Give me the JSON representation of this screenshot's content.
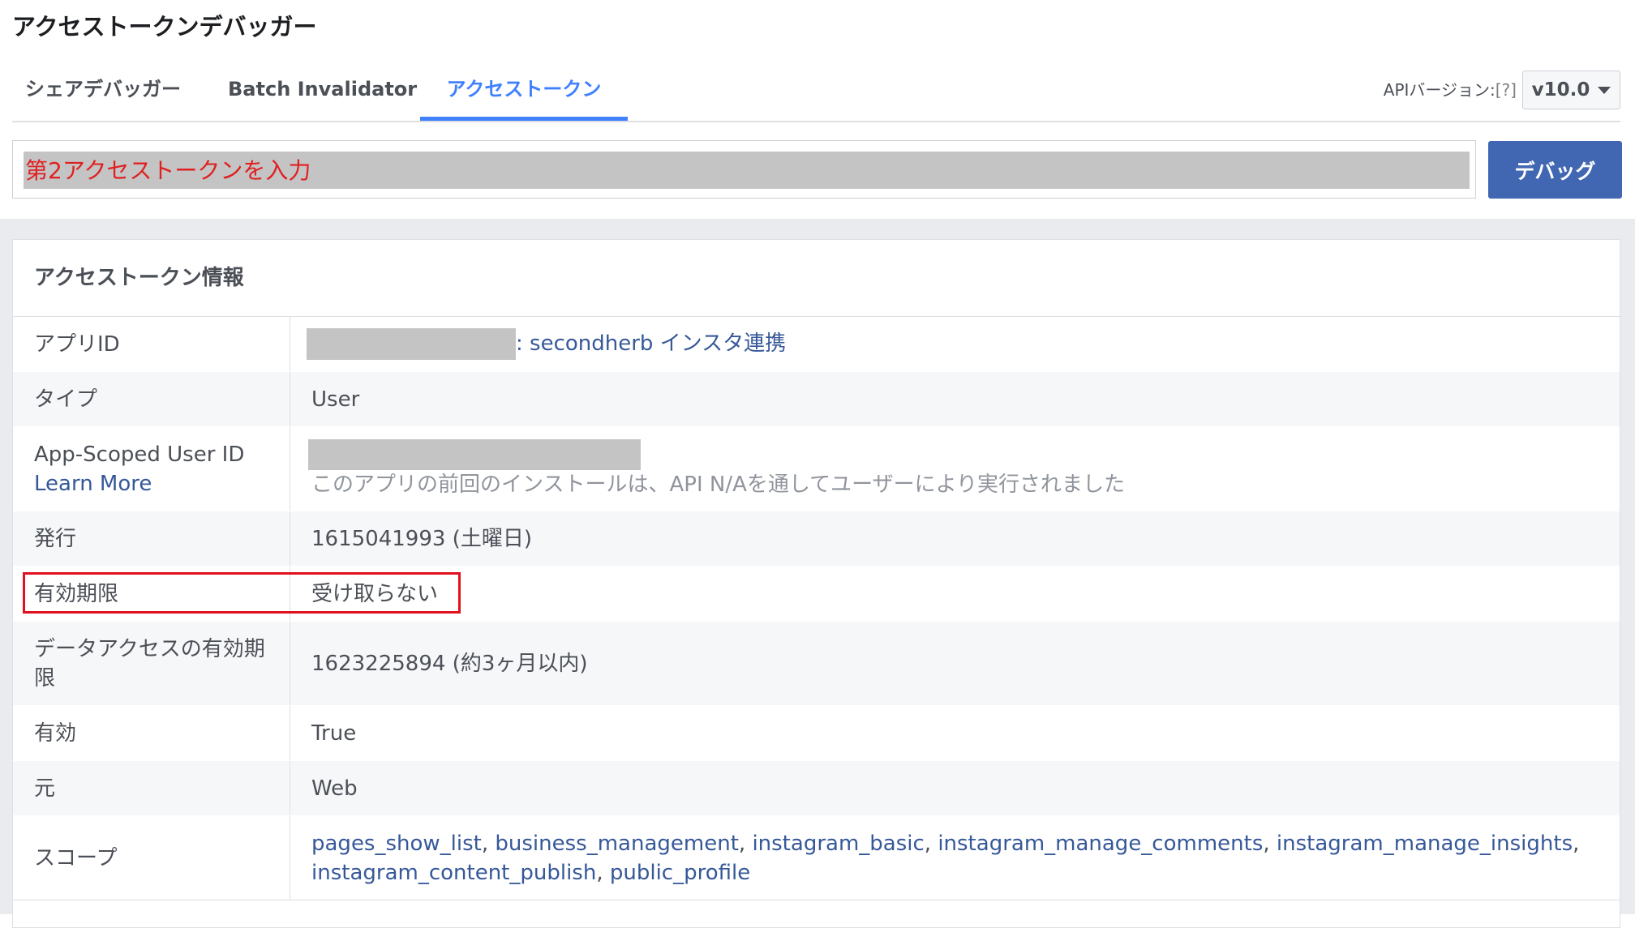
{
  "page_title": "アクセストークンデバッガー",
  "tabs": [
    {
      "label": "シェアデバッガー",
      "active": false
    },
    {
      "label": "Batch Invalidator",
      "active": false
    },
    {
      "label": "アクセストークン",
      "active": true
    }
  ],
  "api_version": {
    "label": "APIバージョン:",
    "help": "[?]",
    "selected": "v10.0"
  },
  "token_input": {
    "placeholder": "第2アクセストークンを入力"
  },
  "debug_button": "デバッグ",
  "panel": {
    "title": "アクセストークン情報",
    "rows": {
      "app_id": {
        "label": "アプリID",
        "value": ": secondherb インスタ連携"
      },
      "type": {
        "label": "タイプ",
        "value": "User"
      },
      "app_scoped_user_id": {
        "label": "App-Scoped User ID",
        "learn_more": "Learn More",
        "note": "このアプリの前回のインストールは、API N/Aを通してユーザーにより実行されました"
      },
      "issued": {
        "label": "発行",
        "value": "1615041993 (土曜日)"
      },
      "expires": {
        "label": "有効期限",
        "value": "受け取らない"
      },
      "data_access_expires": {
        "label": "データアクセスの有効期限",
        "value": "1623225894 (約3ヶ月以内)"
      },
      "valid": {
        "label": "有効",
        "value": "True"
      },
      "origin": {
        "label": "元",
        "value": "Web"
      },
      "scopes": {
        "label": "スコープ",
        "items": [
          "pages_show_list",
          "business_management",
          "instagram_basic",
          "instagram_manage_comments",
          "instagram_manage_insights",
          "instagram_content_publish",
          "public_profile"
        ]
      }
    }
  },
  "colors": {
    "active_tab": "#4080ff",
    "debug_button": "#4267b2",
    "link": "#365899",
    "placeholder_text": "#e02020",
    "highlight_border": "#e0101e",
    "page_background": "#e9ebee"
  }
}
